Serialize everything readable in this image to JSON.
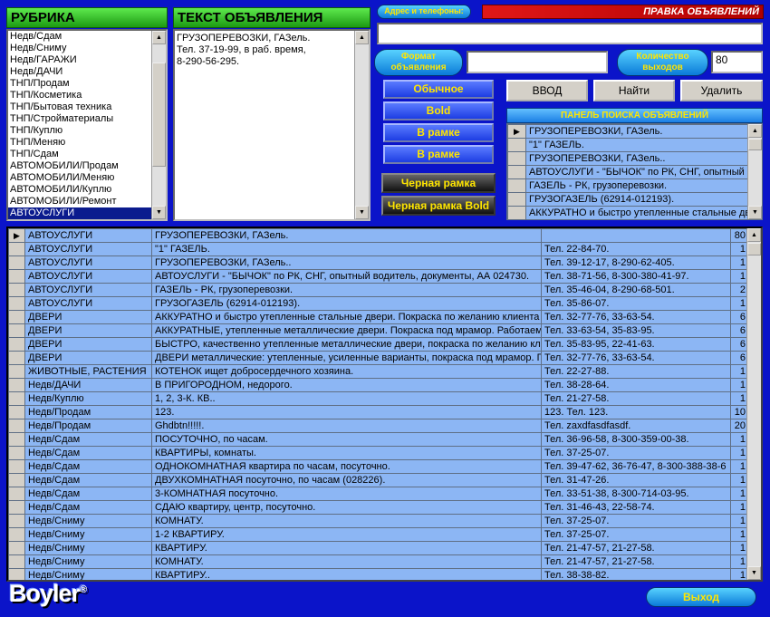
{
  "rubric": {
    "header": "РУБРИКА",
    "items": [
      "Недв/Сдам",
      "Недв/Сниму",
      "Недв/ГАРАЖИ",
      "Недв/ДАЧИ",
      "ТНП/Продам",
      "ТНП/Косметика",
      "ТНП/Бытовая техника",
      "ТНП/Стройматериалы",
      "ТНП/Куплю",
      "ТНП/Меняю",
      "ТНП/Сдам",
      "АВТОМОБИЛИ/Продам",
      "АВТОМОБИЛИ/Меняю",
      "АВТОМОБИЛИ/Куплю",
      "АВТОМОБИЛИ/Ремонт",
      "АВТОУСЛУГИ"
    ],
    "selected_index": 15
  },
  "ad_text": {
    "header": "ТЕКСТ ОБЪЯВЛЕНИЯ",
    "lines": [
      "ГРУЗОПЕРЕВОЗКИ, ГАЗель.",
      "Тел. 37-19-99, в раб. время,",
      "8-290-56-295."
    ]
  },
  "address_label": "Адрес и телефоны:",
  "address_value": "",
  "edit_title": "ПРАВКА ОБЪЯВЛЕНИЙ",
  "format_label": "Формат объявления",
  "format_value": "",
  "count_label": "Количество выходов",
  "count_value": "80",
  "format_buttons": [
    "Обычное",
    "Bold",
    "В рамке",
    "В рамке"
  ],
  "black_buttons": [
    "Черная рамка",
    "Черная рамка Bold"
  ],
  "actions": {
    "enter": "ВВОД",
    "find": "Найти",
    "delete": "Удалить"
  },
  "search_panel": {
    "title": "ПАНЕЛЬ ПОИСКА ОБЪЯВЛЕНИЙ",
    "rows": [
      "ГРУЗОПЕРЕВОЗКИ, ГАЗель.",
      "\"1\" ГАЗЕЛЬ.",
      "ГРУЗОПЕРЕВОЗКИ, ГАЗель..",
      "АВТОУСЛУГИ - \"БЫЧОК\" по РК, СНГ, опытный",
      "ГАЗЕЛЬ - РК, грузоперевозки.",
      "ГРУЗОГАЗЕЛЬ (62914-012193).",
      "АККУРАТНО и быстро утепленные стальные дв"
    ]
  },
  "table": {
    "rows": [
      [
        "АВТОУСЛУГИ",
        "ГРУЗОПЕРЕВОЗКИ, ГАЗель.",
        "",
        "80"
      ],
      [
        "АВТОУСЛУГИ",
        "\"1\" ГАЗЕЛЬ.",
        "Тел. 22-84-70.",
        "1"
      ],
      [
        "АВТОУСЛУГИ",
        "ГРУЗОПЕРЕВОЗКИ, ГАЗель..",
        "Тел. 39-12-17, 8-290-62-405.",
        "1"
      ],
      [
        "АВТОУСЛУГИ",
        "АВТОУСЛУГИ - \"БЫЧОК\" по РК, СНГ, опытный водитель, документы, АА 024730.",
        "Тел. 38-71-56, 8-300-380-41-97.",
        "1"
      ],
      [
        "АВТОУСЛУГИ",
        "ГАЗЕЛЬ - РК, грузоперевозки.",
        "Тел. 35-46-04, 8-290-68-501.",
        "2"
      ],
      [
        "АВТОУСЛУГИ",
        "ГРУЗОГАЗЕЛЬ (62914-012193).",
        "Тел. 35-86-07.",
        "1"
      ],
      [
        "ДВЕРИ",
        "АККУРАТНО и быстро утепленные стальные двери. Покраска по желанию клиента",
        "Тел. 32-77-76, 33-63-54.",
        "6"
      ],
      [
        "ДВЕРИ",
        "АККУРАТНЫЕ, утепленные металлические двери. Покраска под мрамор. Работаем",
        "Тел. 33-63-54, 35-83-95.",
        "6"
      ],
      [
        "ДВЕРИ",
        "БЫСТРО, качественно утепленные металлические двери, покраска по желанию кл",
        "Тел. 35-83-95, 22-41-63.",
        "6"
      ],
      [
        "ДВЕРИ",
        "ДВЕРИ металлические: утепленные, усиленные варианты, покраска под мрамор. П",
        "Тел. 32-77-76, 33-63-54.",
        "6"
      ],
      [
        "ЖИВОТНЫЕ, РАСТЕНИЯ",
        "КОТЕНОК ищет добросердечного хозяина.",
        "Тел. 22-27-88.",
        "1"
      ],
      [
        "Недв/ДАЧИ",
        "В ПРИГОРОДНОМ, недорого.",
        "Тел. 38-28-64.",
        "1"
      ],
      [
        "Недв/Куплю",
        "1, 2, 3-К. КВ..",
        "Тел. 21-27-58.",
        "1"
      ],
      [
        "Недв/Продам",
        "123.",
        "123. Тел. 123.",
        "10"
      ],
      [
        "Недв/Продам",
        "Ghdbtn!!!!!.",
        "Тел. zaxdfasdfasdf.",
        "20"
      ],
      [
        "Недв/Сдам",
        "ПОСУТОЧНО, по часам.",
        "Тел. 36-96-58, 8-300-359-00-38.",
        "1"
      ],
      [
        "Недв/Сдам",
        "КВАРТИРЫ, комнаты.",
        "Тел. 37-25-07.",
        "1"
      ],
      [
        "Недв/Сдам",
        "ОДНОКОМНАТНАЯ квартира по часам, посуточно.",
        "Тел. 39-47-62, 36-76-47, 8-300-388-38-6",
        "1"
      ],
      [
        "Недв/Сдам",
        "ДВУХКОМНАТНАЯ посуточно, по часам (028226).",
        "Тел. 31-47-26.",
        "1"
      ],
      [
        "Недв/Сдам",
        "3-КОМНАТНАЯ посуточно.",
        "Тел. 33-51-38, 8-300-714-03-95.",
        "1"
      ],
      [
        "Недв/Сдам",
        "СДАЮ квартиру, центр, посуточно.",
        "Тел. 31-46-43, 22-58-74.",
        "1"
      ],
      [
        "Недв/Сниму",
        "КОМНАТУ.",
        "Тел. 37-25-07.",
        "1"
      ],
      [
        "Недв/Сниму",
        "1-2 КВАРТИРУ.",
        "Тел. 37-25-07.",
        "1"
      ],
      [
        "Недв/Сниму",
        "КВАРТИРУ.",
        "Тел. 21-47-57, 21-27-58.",
        "1"
      ],
      [
        "Недв/Сниму",
        "КОМНАТУ.",
        "Тел. 21-47-57, 21-27-58.",
        "1"
      ],
      [
        "Недв/Сниму",
        "КВАРТИРУ..",
        "Тел. 38-38-82.",
        "1"
      ]
    ]
  },
  "logo": "Boyler",
  "exit_label": "Выход",
  "colors": {
    "background": "#0b14c9",
    "grid_row": "#8cb6f4",
    "header_green": "#2fc01f",
    "button_text": "#ffe600"
  }
}
